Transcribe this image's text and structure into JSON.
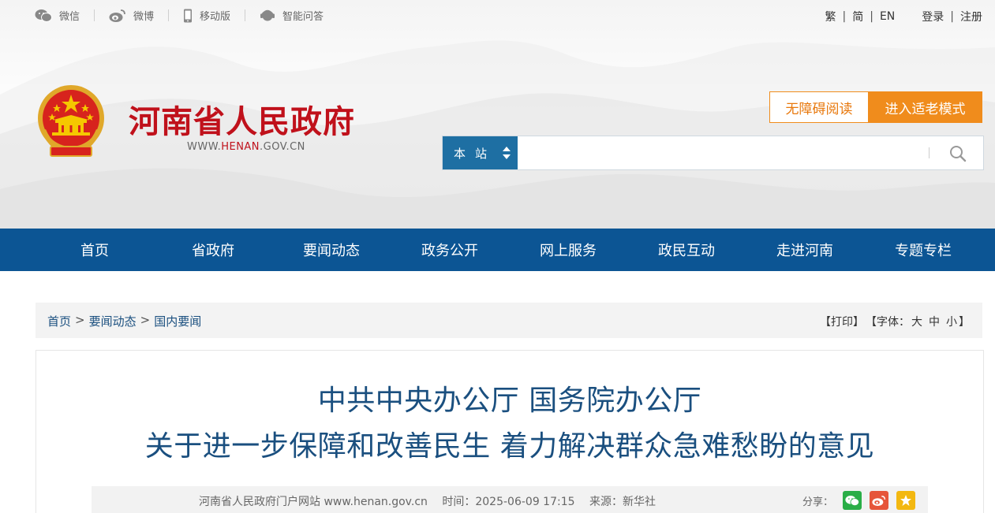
{
  "topbar": {
    "links": [
      {
        "label": "微信",
        "icon": "wechat-icon"
      },
      {
        "label": "微博",
        "icon": "weibo-icon"
      },
      {
        "label": "移动版",
        "icon": "mobile-icon"
      },
      {
        "label": "智能问答",
        "icon": "assistant-icon"
      }
    ],
    "lang": {
      "traditional": "繁",
      "simplified": "简",
      "english": "EN",
      "sep": "|"
    },
    "account": {
      "login": "登录",
      "register": "注册",
      "sep": "|"
    }
  },
  "header": {
    "title": "河南省人民政府",
    "url_prefix": "WWW.",
    "url_highlight": "HENAN",
    "url_suffix": ".GOV.CN",
    "accessibility_label": "无障碍阅读",
    "elder_mode_label": "进入适老模式"
  },
  "search": {
    "scope_label": "本站",
    "placeholder": "",
    "value": ""
  },
  "nav": {
    "items": [
      "首页",
      "省政府",
      "要闻动态",
      "政务公开",
      "网上服务",
      "政民互动",
      "走进河南",
      "专题专栏"
    ]
  },
  "breadcrumb": {
    "items": [
      "首页",
      "要闻动态",
      "国内要闻"
    ],
    "sep": ">"
  },
  "tools": {
    "print": "【打印】",
    "font_prefix": "【字体：",
    "font_large": "大",
    "font_medium": "中",
    "font_small": "小",
    "font_suffix": "】"
  },
  "article": {
    "title_line1": "中共中央办公厅 国务院办公厅",
    "title_line2": "关于进一步保障和改善民生 着力解决群众急难愁盼的意见",
    "source_site": "河南省人民政府门户网站 www.henan.gov.cn",
    "time": "时间：2025-06-09 17:15",
    "source": "来源：新华社",
    "share_label": "分享："
  },
  "colors": {
    "brand_red": "#c0111b",
    "nav_blue": "#0c5594",
    "title_blue": "#1a4f7f",
    "accent_orange": "#f08c1c",
    "wechat_green": "#2aae47",
    "weibo_red": "#e6553a",
    "favorite_yellow": "#f3b811"
  }
}
